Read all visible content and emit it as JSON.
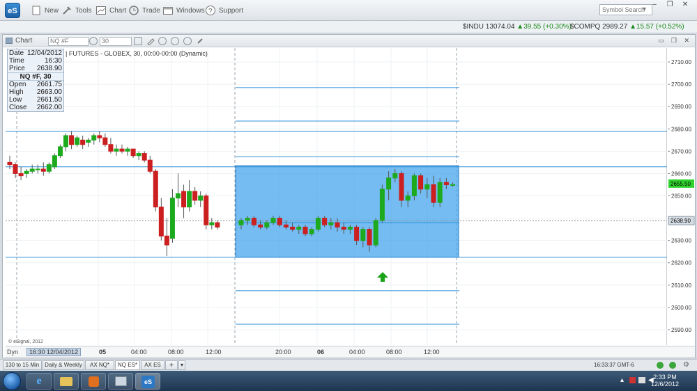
{
  "app": {
    "logo_text": "eS",
    "toolbar": [
      {
        "label": "New",
        "icon": "new-icon"
      },
      {
        "label": "Tools",
        "icon": "tools-icon"
      },
      {
        "label": "Chart",
        "icon": "chart-icon"
      },
      {
        "label": "Trade",
        "icon": "trade-icon"
      },
      {
        "label": "Windows",
        "icon": "windows-icon"
      },
      {
        "label": "Support",
        "icon": "support-icon"
      }
    ],
    "search_placeholder": "Symbol Search"
  },
  "ticker": [
    {
      "symbol": "$INDU",
      "price": "13074.04",
      "change": "39.55 (+0.30%)",
      "direction": "up"
    },
    {
      "symbol": "$COMPQ",
      "price": "2989.27",
      "change": "15.57 (+0.52%)",
      "direction": "up"
    }
  ],
  "chart_window": {
    "label": "Chart",
    "symbol_field": "NQ #F",
    "interval_field": "30",
    "title": "| FUTURES - GLOBEX, 30, 00:00-00:00 (Dynamic)",
    "credit": "© eSignal, 2012",
    "info": {
      "date_label": "Date",
      "date": "12/04/2012",
      "time_label": "Time",
      "time": "16:30",
      "price_label": "Price",
      "price": "2638.90",
      "header": "NQ #F, 30",
      "open_label": "Open",
      "open": "2661.75",
      "high_label": "High",
      "high": "2663.00",
      "low_label": "Low",
      "low": "2661.50",
      "close_label": "Close",
      "close": "2662.00"
    },
    "time_axis": {
      "dyn_label": "Dyn",
      "cursor_label": "16:30 12/04/2012",
      "labels": [
        "05",
        "04:00",
        "08:00",
        "12:00",
        "20:00",
        "06",
        "04:00",
        "08:00",
        "12:00"
      ]
    },
    "current_price_label": "2655.50",
    "cursor_price_label": "2638.90"
  },
  "tabs": [
    "130 to 15 Min",
    "Daily & Weekly",
    "AX NQ*",
    "NQ ES*",
    "AX ES",
    "+"
  ],
  "active_tab": "NQ ES*",
  "status_clock": "16:33:37 GMT-6",
  "taskbar": {
    "time": "2:33 PM",
    "date": "12/6/2012"
  },
  "chart_data": {
    "type": "candlestick",
    "symbol": "NQ #F",
    "interval": "30",
    "ylim": [
      2585,
      2715
    ],
    "yticks": [
      2590,
      2600,
      2610,
      2620,
      2630,
      2640,
      2650,
      2660,
      2670,
      2680,
      2690,
      2700,
      2710
    ],
    "grid": true,
    "horizontal_lines": [
      2698.5,
      2683.5,
      2679,
      2667.5,
      2663,
      2638,
      2622.5,
      2607.5,
      2592.5
    ],
    "highlight_range": {
      "from_bar": 46,
      "to_bar": 93,
      "high": 2663.5,
      "low": 2622.5
    },
    "candles": [
      [
        2665,
        2668,
        2662,
        2664
      ],
      [
        2664,
        2665,
        2658,
        2660
      ],
      [
        2660,
        2663,
        2657,
        2659
      ],
      [
        2660,
        2662,
        2658,
        2661
      ],
      [
        2661,
        2664,
        2660,
        2662
      ],
      [
        2662,
        2664,
        2660,
        2662
      ],
      [
        2662,
        2665,
        2659,
        2661
      ],
      [
        2661,
        2665,
        2660,
        2664
      ],
      [
        2663,
        2669,
        2662,
        2668
      ],
      [
        2668,
        2673,
        2667,
        2672
      ],
      [
        2672,
        2678,
        2670,
        2677
      ],
      [
        2677,
        2679,
        2671,
        2673
      ],
      [
        2673,
        2677,
        2672,
        2676
      ],
      [
        2675,
        2677,
        2671,
        2673
      ],
      [
        2674,
        2676,
        2672,
        2675
      ],
      [
        2675,
        2678,
        2673,
        2677
      ],
      [
        2677,
        2679,
        2674,
        2676
      ],
      [
        2676,
        2678,
        2672,
        2673
      ],
      [
        2673,
        2676,
        2669,
        2670
      ],
      [
        2670,
        2673,
        2668,
        2671
      ],
      [
        2671,
        2673,
        2669,
        2670
      ],
      [
        2670,
        2672,
        2668,
        2671
      ],
      [
        2671,
        2671,
        2667,
        2668
      ],
      [
        2668,
        2670,
        2666,
        2669
      ],
      [
        2669,
        2670,
        2665,
        2666
      ],
      [
        2666,
        2668,
        2660,
        2661
      ],
      [
        2661,
        2662,
        2643,
        2645
      ],
      [
        2645,
        2649,
        2630,
        2632
      ],
      [
        2632,
        2640,
        2623,
        2628
      ],
      [
        2631,
        2653,
        2629,
        2649
      ],
      [
        2649,
        2660,
        2645,
        2651
      ],
      [
        2652,
        2655,
        2640,
        2645
      ],
      [
        2645,
        2657,
        2643,
        2652
      ],
      [
        2652,
        2654,
        2646,
        2648
      ],
      [
        2648,
        2652,
        2645,
        2650
      ],
      [
        2650,
        2651,
        2635,
        2637
      ],
      [
        2637,
        2640,
        2635,
        2638
      ],
      [
        2638,
        2639,
        2635,
        2636
      ],
      [
        2637,
        2640,
        2635,
        2639
      ],
      [
        2639,
        2641,
        2637,
        2640
      ],
      [
        2640,
        2641,
        2636,
        2637
      ],
      [
        2637,
        2639,
        2635,
        2636
      ],
      [
        2636,
        2639,
        2635,
        2638
      ],
      [
        2638,
        2641,
        2637,
        2640
      ],
      [
        2640,
        2641,
        2636,
        2637
      ],
      [
        2637,
        2639,
        2635,
        2636
      ],
      [
        2636,
        2638,
        2634,
        2635
      ],
      [
        2635,
        2637,
        2633,
        2636
      ],
      [
        2636,
        2637,
        2632,
        2633
      ],
      [
        2633,
        2636,
        2632,
        2635
      ],
      [
        2635,
        2641,
        2634,
        2640
      ],
      [
        2640,
        2641,
        2636,
        2637
      ],
      [
        2637,
        2640,
        2635,
        2638
      ],
      [
        2638,
        2640,
        2634,
        2636
      ],
      [
        2636,
        2638,
        2633,
        2635
      ],
      [
        2635,
        2637,
        2633,
        2636
      ],
      [
        2636,
        2637,
        2628,
        2630
      ],
      [
        2630,
        2636,
        2627,
        2635
      ],
      [
        2635,
        2636,
        2625,
        2628
      ],
      [
        2628,
        2640,
        2627,
        2639
      ],
      [
        2639,
        2655,
        2638,
        2653
      ],
      [
        2653,
        2661,
        2648,
        2658
      ],
      [
        2658,
        2662,
        2656,
        2660
      ],
      [
        2660,
        2661,
        2645,
        2648
      ],
      [
        2648,
        2652,
        2645,
        2650
      ],
      [
        2650,
        2660,
        2648,
        2659
      ],
      [
        2659,
        2660,
        2651,
        2653
      ],
      [
        2653,
        2658,
        2649,
        2655
      ],
      [
        2655,
        2659,
        2645,
        2647
      ],
      [
        2647,
        2658,
        2645,
        2656
      ],
      [
        2656,
        2658,
        2653,
        2655
      ],
      [
        2655,
        2656,
        2654,
        2655
      ]
    ]
  }
}
